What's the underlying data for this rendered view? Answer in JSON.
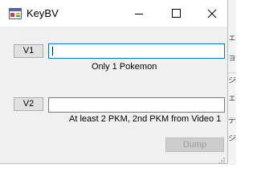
{
  "window": {
    "title": "KeyBV"
  },
  "v1": {
    "button_label": "V1",
    "input_value": "",
    "hint": "Only 1 Pokemon"
  },
  "v2": {
    "button_label": "V2",
    "input_value": "",
    "hint": "At least 2 PKM, 2nd PKM from Video 1"
  },
  "actions": {
    "dump_label": "Dump"
  },
  "icons": {
    "app": "app-window-icon",
    "minimize": "minimize-icon",
    "maximize": "maximize-icon",
    "close": "close-icon"
  },
  "background_text": [
    "ェ",
    "ョ",
    "ジ",
    "ェ",
    "デ",
    "ジ"
  ],
  "colors": {
    "focus_border": "#0078d7",
    "dialog_bg": "#f0f0f0"
  }
}
